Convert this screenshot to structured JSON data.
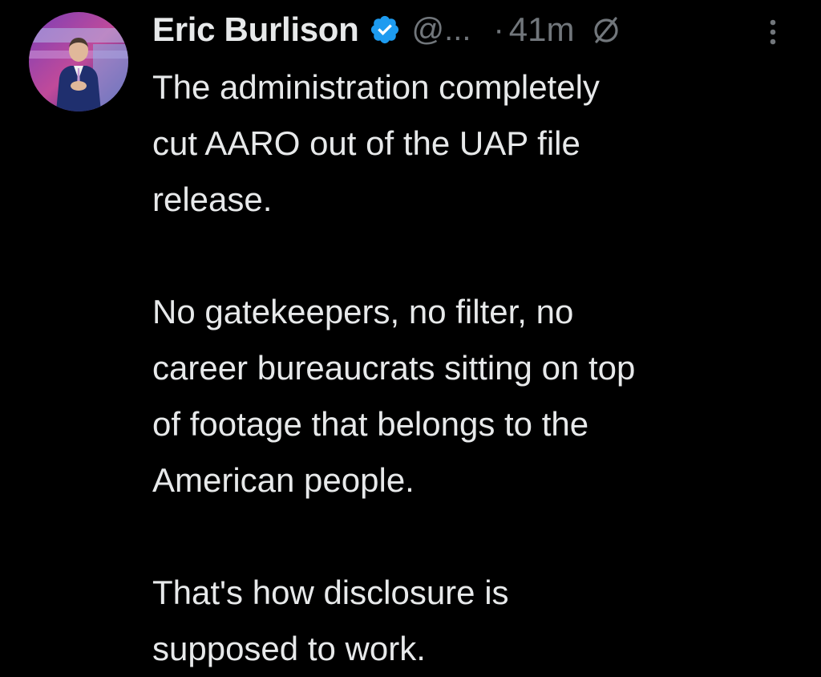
{
  "tweet": {
    "author": {
      "name": "Eric Burlison",
      "handle": "@...",
      "verified": true,
      "verified_color": "#1d9bf0"
    },
    "separator": "·",
    "timestamp": "41m",
    "icons": {
      "avatar": "avatar-photo",
      "verified": "verified-badge-icon",
      "muted": "muted-icon",
      "more": "more-vertical-icon"
    },
    "paragraphs": [
      "The administration completely\ncut AARO out of the UAP file\nrelease.",
      "No gatekeepers, no filter, no\ncareer bureaucrats sitting on top\nof footage that belongs to the\nAmerican people.",
      "That's how disclosure is\nsupposed to work."
    ]
  },
  "colors": {
    "background": "#000000",
    "text_primary": "#e7e9ea",
    "text_secondary": "#71767b",
    "accent": "#1d9bf0"
  }
}
